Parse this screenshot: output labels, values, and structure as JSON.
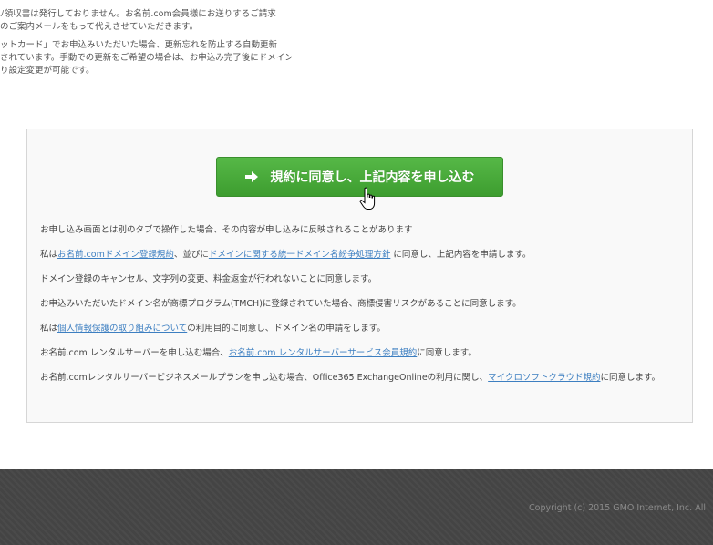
{
  "notes": {
    "line1": "ﾉ領収書は発行しておりません。お名前.com会員様にお送りするご請求",
    "line2": "のご案内メールをもって代えさせていただきます。",
    "line3": "ットカード」でお申込みいただいた場合、更新忘れを防止する自動更新",
    "line4": "されています。手動での更新をご希望の場合は、お申込み完了後にドメイン",
    "line5": "り設定変更が可能です。"
  },
  "submit": {
    "label": "規約に同意し、上記内容を申し込む"
  },
  "terms": {
    "tab_warning": "お申し込み画面とは別のタブで操作した場合、その内容が申し込みに反映されることがあります",
    "domain_pre": "私は",
    "domain_link1": "お名前.comドメイン登録規約",
    "domain_mid": "、並びに",
    "domain_link2": "ドメインに関する統一ドメイン名紛争処理方針",
    "domain_post": " に同意し、上記内容を申請します。",
    "cancel": "ドメイン登録のキャンセル、文字列の変更、料金返金が行われないことに同意します。",
    "tmch": "お申込みいただいたドメイン名が商標プログラム(TMCH)に登録されていた場合、商標侵害リスクがあることに同意します。",
    "privacy_pre": "私は",
    "privacy_link": "個人情報保護の取り組みについて",
    "privacy_post": "の利用目的に同意し、ドメイン名の申請をします。",
    "server_pre": "お名前.com レンタルサーバーを申し込む場合、",
    "server_link": "お名前.com レンタルサーバーサービス会員規約",
    "server_post": "に同意します。",
    "mail_pre": "お名前.comレンタルサーバービジネスメールプランを申し込む場合、Office365 ExchangeOnlineの利用に関し、",
    "mail_link": "マイクロソフトクラウド規約",
    "mail_post": "に同意します。"
  },
  "footer": {
    "copyright": "Copyright (c) 2015 GMO Internet, Inc. All"
  },
  "colors": {
    "button": "#46a83a",
    "link": "#3d7fc1",
    "footer": "#444444"
  },
  "icons": {
    "button": "arrow-right-icon",
    "cursor": "hand-pointer-icon"
  }
}
